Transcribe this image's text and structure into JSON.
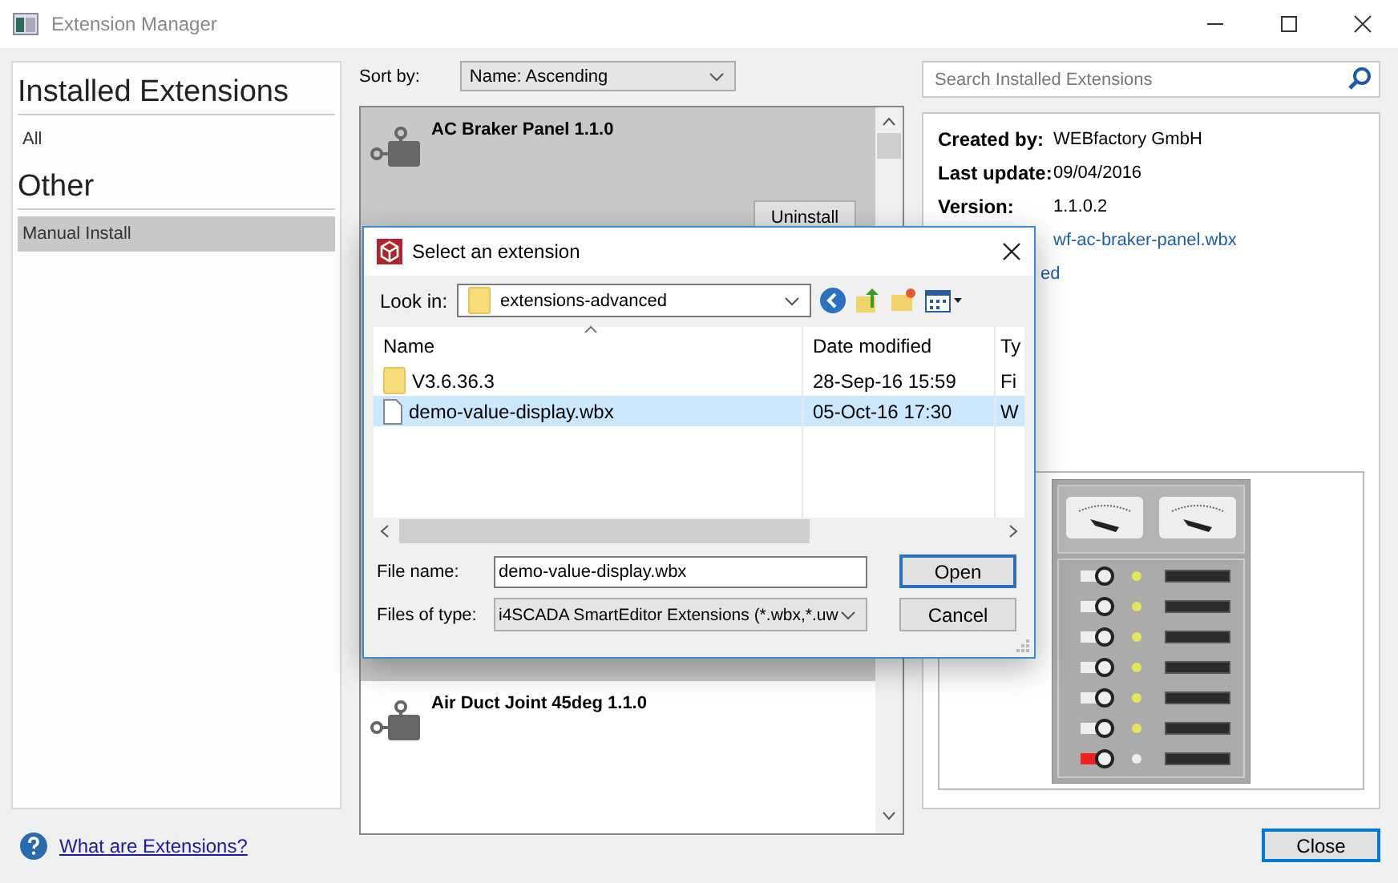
{
  "window": {
    "title": "Extension Manager"
  },
  "sidebar": {
    "sections": [
      {
        "heading": "Installed Extensions",
        "items": [
          {
            "label": "All",
            "selected": false
          }
        ]
      },
      {
        "heading": "Other",
        "items": [
          {
            "label": "Manual Install",
            "selected": true
          }
        ]
      }
    ]
  },
  "sort": {
    "label": "Sort by:",
    "value": "Name: Ascending"
  },
  "extensions": [
    {
      "name": "AC Braker Panel 1.1.0",
      "selected": true,
      "action": "Uninstall"
    },
    {
      "name": "Air Duct Joint 45deg 1.1.0",
      "selected": false
    }
  ],
  "search": {
    "placeholder": "Search Installed Extensions"
  },
  "details": {
    "rows": [
      {
        "label": "Created by:",
        "value": "WEBfactory GmbH",
        "kind": "text"
      },
      {
        "label": "Last update:",
        "value": "09/04/2016",
        "kind": "text"
      },
      {
        "label": "Version:",
        "value": "1.1.0.2",
        "kind": "text"
      },
      {
        "value": "wf-ac-braker-panel.wbx",
        "kind": "link"
      }
    ],
    "link_fragment": "ed"
  },
  "dialog": {
    "title": "Select an extension",
    "look_in_label": "Look in:",
    "look_in": "extensions-advanced",
    "columns": [
      "Name",
      "Date modified",
      "Ty"
    ],
    "files": [
      {
        "kind": "folder",
        "name": "V3.6.36.3",
        "date": "28-Sep-16 15:59",
        "type": "Fi",
        "selected": false
      },
      {
        "kind": "file",
        "name": "demo-value-display.wbx",
        "date": "05-Oct-16 17:30",
        "type": "W",
        "selected": true
      }
    ],
    "file_name_label": "File name:",
    "file_name": "demo-value-display.wbx",
    "file_type_label": "Files of type:",
    "file_type": "i4SCADA SmartEditor Extensions (*.wbx,*.uw",
    "buttons": [
      "Open",
      "Cancel"
    ]
  },
  "help_link": "What are Extensions?",
  "close_button": "Close"
}
